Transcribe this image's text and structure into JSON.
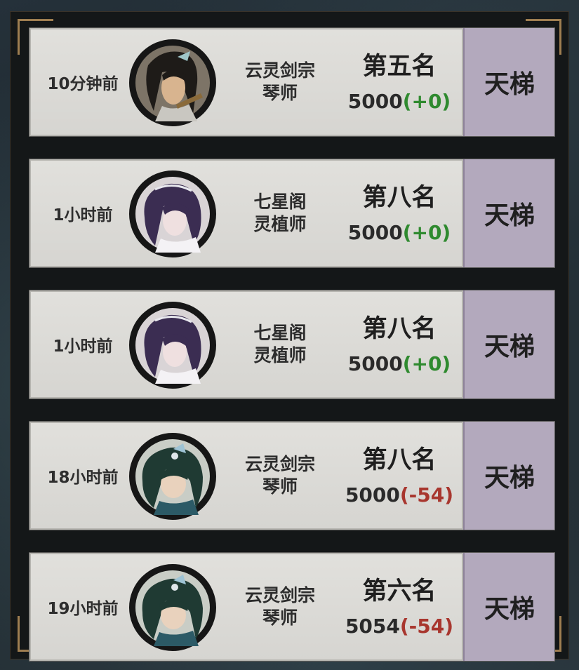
{
  "records": [
    {
      "time": "10分钟前",
      "sect": "云灵剑宗",
      "role": "琴师",
      "rank": "第五名",
      "score": "5000",
      "delta": "(+0)",
      "delta_type": "pos",
      "mode": "天梯",
      "avatar": "dark-haired-swordsman-icon"
    },
    {
      "time": "1小时前",
      "sect": "七星阁",
      "role": "灵植师",
      "rank": "第八名",
      "score": "5000",
      "delta": "(+0)",
      "delta_type": "pos",
      "mode": "天梯",
      "avatar": "purple-haired-woman-icon"
    },
    {
      "time": "1小时前",
      "sect": "七星阁",
      "role": "灵植师",
      "rank": "第八名",
      "score": "5000",
      "delta": "(+0)",
      "delta_type": "pos",
      "mode": "天梯",
      "avatar": "purple-haired-woman-icon"
    },
    {
      "time": "18小时前",
      "sect": "云灵剑宗",
      "role": "琴师",
      "rank": "第八名",
      "score": "5000",
      "delta": "(-54)",
      "delta_type": "neg",
      "mode": "天梯",
      "avatar": "green-haired-girl-icon"
    },
    {
      "time": "19小时前",
      "sect": "云灵剑宗",
      "role": "琴师",
      "rank": "第六名",
      "score": "5054",
      "delta": "(-54)",
      "delta_type": "neg",
      "mode": "天梯",
      "avatar": "green-haired-girl-icon"
    }
  ],
  "colors": {
    "positive": "#2f8a2f",
    "negative": "#a8362e",
    "mode_bg": "#b3a9bd",
    "card_bg": "#dcdbd7",
    "frame_accent": "#b8905c"
  }
}
